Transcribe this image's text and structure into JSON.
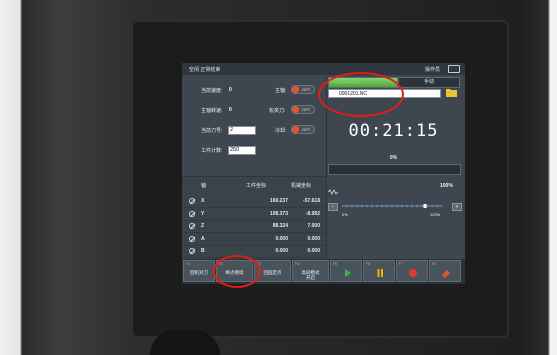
{
  "screen": {
    "mode_text": "空闲 正常结束",
    "operator_label": "操作员",
    "program": {
      "progress_text": "···················",
      "progress_fraction": 1.0,
      "manual_label": "手动",
      "filename": "0001201.NC",
      "timer": "00:21:15",
      "percent": "0%"
    },
    "status": {
      "spindle_speed_label": "当前速度:",
      "spindle_speed_value": "0",
      "spindle_rpm_label": "主轴转速:",
      "spindle_rpm_value": "0",
      "tool_label": "当前刀号:",
      "tool_value": "2",
      "workpiece_label": "工件计数:",
      "workpiece_value": "250",
      "spindle_label": "主轴:",
      "spindle_state": "OFF",
      "clamp_label": "松夹刀:",
      "clamp_state": "OFF",
      "coolant_label": "冷却:",
      "coolant_state": "OFF"
    },
    "axes": {
      "headers": {
        "axis": "轴",
        "work": "工件坐标",
        "machine": "机械坐标"
      },
      "rows": [
        {
          "name": "X",
          "work": "169.237",
          "machine": "-57.618"
        },
        {
          "name": "Y",
          "work": "108.373",
          "machine": "-8.992"
        },
        {
          "name": "Z",
          "work": "88.324",
          "machine": "7.000"
        },
        {
          "name": "A",
          "work": "0.000",
          "machine": "0.000"
        },
        {
          "name": "B",
          "work": "0.000",
          "machine": "0.000"
        }
      ]
    },
    "feed": {
      "percent": "100%",
      "min_label": "0%",
      "max_label": "120%",
      "value_fraction": 0.83
    },
    "buttons": [
      {
        "key": "F1",
        "label": "回机对刀"
      },
      {
        "key": "F2",
        "label": "断点继续"
      },
      {
        "key": "F3",
        "label": "回固定点"
      },
      {
        "key": "F4",
        "label": "高同模式\n开启"
      },
      {
        "key": "F5",
        "icon": "play-icon",
        "color": "#3db34a"
      },
      {
        "key": "F6",
        "icon": "pause-icon",
        "color": "#e8b40e"
      },
      {
        "key": "F7",
        "icon": "stop-icon",
        "color": "#e03a2c"
      },
      {
        "key": "F8",
        "icon": "eraser-icon",
        "color": "#e8542f"
      }
    ]
  },
  "annotations": {
    "circle_color": "#e21d12"
  }
}
